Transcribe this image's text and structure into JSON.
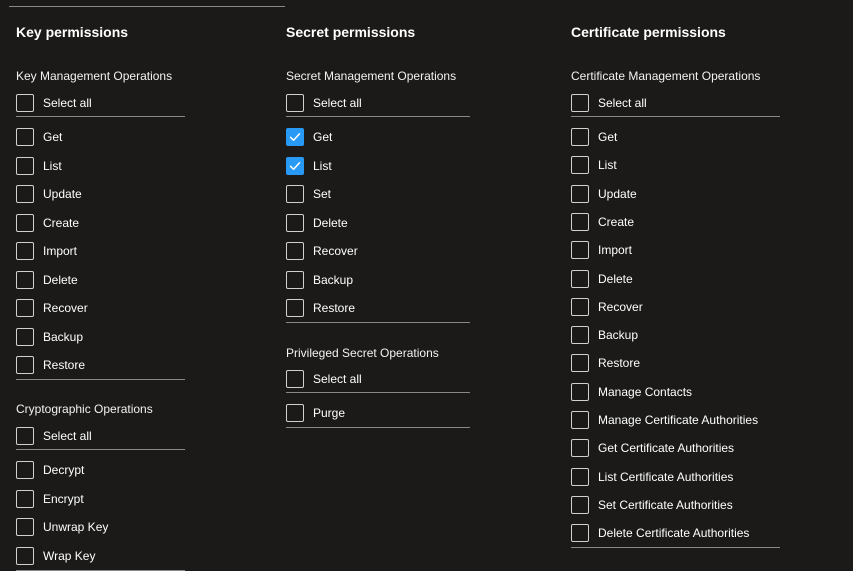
{
  "key": {
    "title": "Key permissions",
    "management": {
      "title": "Key Management Operations",
      "select_all": "Select all",
      "items": [
        {
          "label": "Get",
          "checked": false
        },
        {
          "label": "List",
          "checked": false
        },
        {
          "label": "Update",
          "checked": false
        },
        {
          "label": "Create",
          "checked": false
        },
        {
          "label": "Import",
          "checked": false
        },
        {
          "label": "Delete",
          "checked": false
        },
        {
          "label": "Recover",
          "checked": false
        },
        {
          "label": "Backup",
          "checked": false
        },
        {
          "label": "Restore",
          "checked": false
        }
      ]
    },
    "crypto": {
      "title": "Cryptographic Operations",
      "select_all": "Select all",
      "items": [
        {
          "label": "Decrypt",
          "checked": false
        },
        {
          "label": "Encrypt",
          "checked": false
        },
        {
          "label": "Unwrap Key",
          "checked": false
        },
        {
          "label": "Wrap Key",
          "checked": false
        }
      ]
    }
  },
  "secret": {
    "title": "Secret permissions",
    "management": {
      "title": "Secret Management Operations",
      "select_all": "Select all",
      "items": [
        {
          "label": "Get",
          "checked": true
        },
        {
          "label": "List",
          "checked": true
        },
        {
          "label": "Set",
          "checked": false
        },
        {
          "label": "Delete",
          "checked": false
        },
        {
          "label": "Recover",
          "checked": false
        },
        {
          "label": "Backup",
          "checked": false
        },
        {
          "label": "Restore",
          "checked": false
        }
      ]
    },
    "privileged": {
      "title": "Privileged Secret Operations",
      "select_all": "Select all",
      "items": [
        {
          "label": "Purge",
          "checked": false
        }
      ]
    }
  },
  "cert": {
    "title": "Certificate permissions",
    "management": {
      "title": "Certificate Management Operations",
      "select_all": "Select all",
      "items": [
        {
          "label": "Get",
          "checked": false
        },
        {
          "label": "List",
          "checked": false
        },
        {
          "label": "Update",
          "checked": false
        },
        {
          "label": "Create",
          "checked": false
        },
        {
          "label": "Import",
          "checked": false
        },
        {
          "label": "Delete",
          "checked": false
        },
        {
          "label": "Recover",
          "checked": false
        },
        {
          "label": "Backup",
          "checked": false
        },
        {
          "label": "Restore",
          "checked": false
        },
        {
          "label": "Manage Contacts",
          "checked": false
        },
        {
          "label": "Manage Certificate Authorities",
          "checked": false
        },
        {
          "label": "Get Certificate Authorities",
          "checked": false
        },
        {
          "label": "List Certificate Authorities",
          "checked": false
        },
        {
          "label": "Set Certificate Authorities",
          "checked": false
        },
        {
          "label": "Delete Certificate Authorities",
          "checked": false
        }
      ]
    }
  },
  "colors": {
    "checked": "#2899f5",
    "background": "#1b1a19",
    "border": "#d2d0ce"
  },
  "icons": {
    "checked": "checkmark-icon"
  }
}
